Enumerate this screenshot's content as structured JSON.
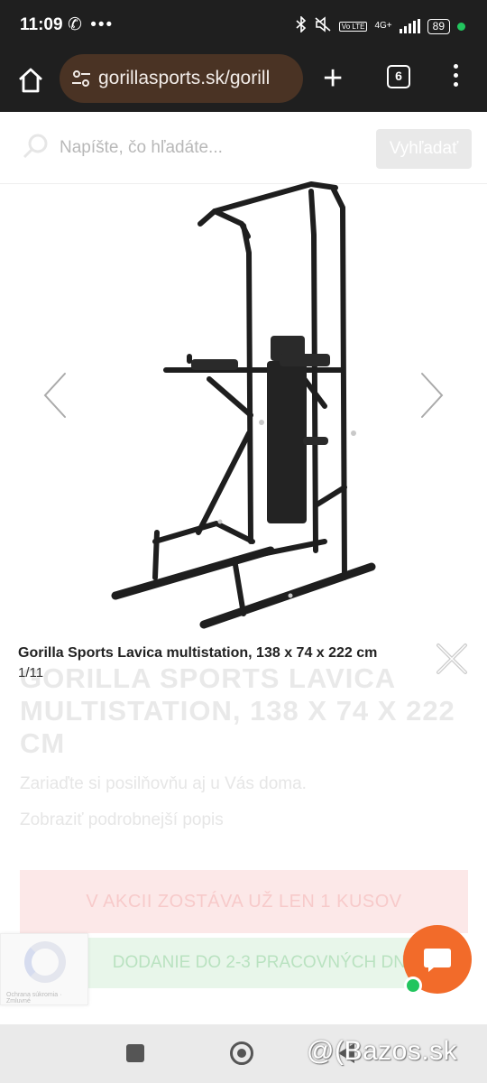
{
  "status_bar": {
    "time": "11:09",
    "left_icons": "✆ •••",
    "volte": "Vo LTE",
    "network": "4G+",
    "battery": "89"
  },
  "browser": {
    "url": "gorillasports.sk/gorill",
    "tab_count": "6",
    "icons": [
      "home-icon",
      "site-settings-icon",
      "new-tab-icon",
      "tab-switcher-icon",
      "menu-icon"
    ]
  },
  "search": {
    "placeholder": "Napíšte, čo hľadáte...",
    "button_label": "Vyhľadať"
  },
  "product": {
    "heading": "GORILLA SPORTS LAVICA MULTISTATION, 138 X 74 X 222 CM",
    "tagline": "Zariaďte si posilňovňu aj u Vás doma.",
    "more_link": "Zobraziť podrobnejší popis",
    "stock_banner": "V AKCII ZOSTÁVA UŽ LEN 1 KUSOV",
    "delivery_banner": "DODANIE DO 2-3 PRACOVNÝCH DNÍ"
  },
  "lightbox": {
    "caption": "Gorilla Sports Lavica multistation, 138 x 74 x 222 cm",
    "counter": "1/11"
  },
  "recaptcha": {
    "text": "Ochrana súkromia · Zmluvné"
  },
  "watermark": "@(Bazos.sk",
  "colors": {
    "chrome_bg": "#1f1f1f",
    "urlbar_bg": "#4a3324",
    "chat_orange": "#f26b2a",
    "online_green": "#22c55e"
  }
}
